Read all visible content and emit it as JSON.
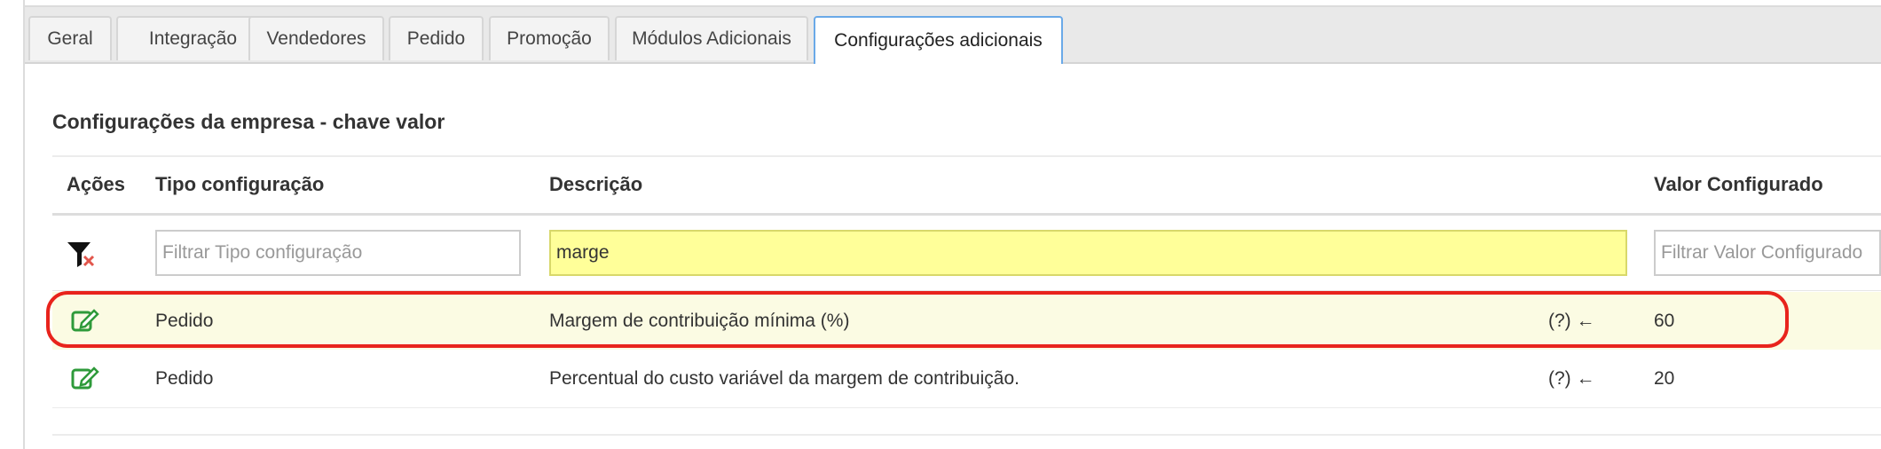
{
  "tabs": [
    {
      "label": "Geral",
      "active": false
    },
    {
      "label": "Integração",
      "active": false
    },
    {
      "label": "Vendedores",
      "active": false
    },
    {
      "label": "Pedido",
      "active": false
    },
    {
      "label": "Promoção",
      "active": false
    },
    {
      "label": "Módulos Adicionais",
      "active": false
    },
    {
      "label": "Configurações adicionais",
      "active": true
    }
  ],
  "section": {
    "title": "Configurações da empresa - chave valor"
  },
  "table": {
    "headers": {
      "actions": "Ações",
      "type": "Tipo configuração",
      "description": "Descrição",
      "value": "Valor Configurado"
    },
    "filters": {
      "type_placeholder": "Filtrar Tipo configuração",
      "description_value": "marge",
      "value_placeholder": "Filtrar Valor Configurado"
    },
    "rows": [
      {
        "type": "Pedido",
        "description": "Margem de contribuição mínima (%)",
        "help": "(?) ←",
        "value": "60",
        "highlighted": true
      },
      {
        "type": "Pedido",
        "description": "Percentual do custo variável da margem de contribuição.",
        "help": "(?) ←",
        "value": "20",
        "highlighted": false
      }
    ]
  },
  "icons": {
    "filter_clear": "filter-clear-icon",
    "edit": "edit-icon"
  },
  "colors": {
    "active_tab_border": "#6aa9e8",
    "highlighted_row": "#fbfbe3",
    "filter_highlight": "#ffff99",
    "annotation_red": "#e8231c",
    "edit_icon_green": "#2e9a3a"
  }
}
